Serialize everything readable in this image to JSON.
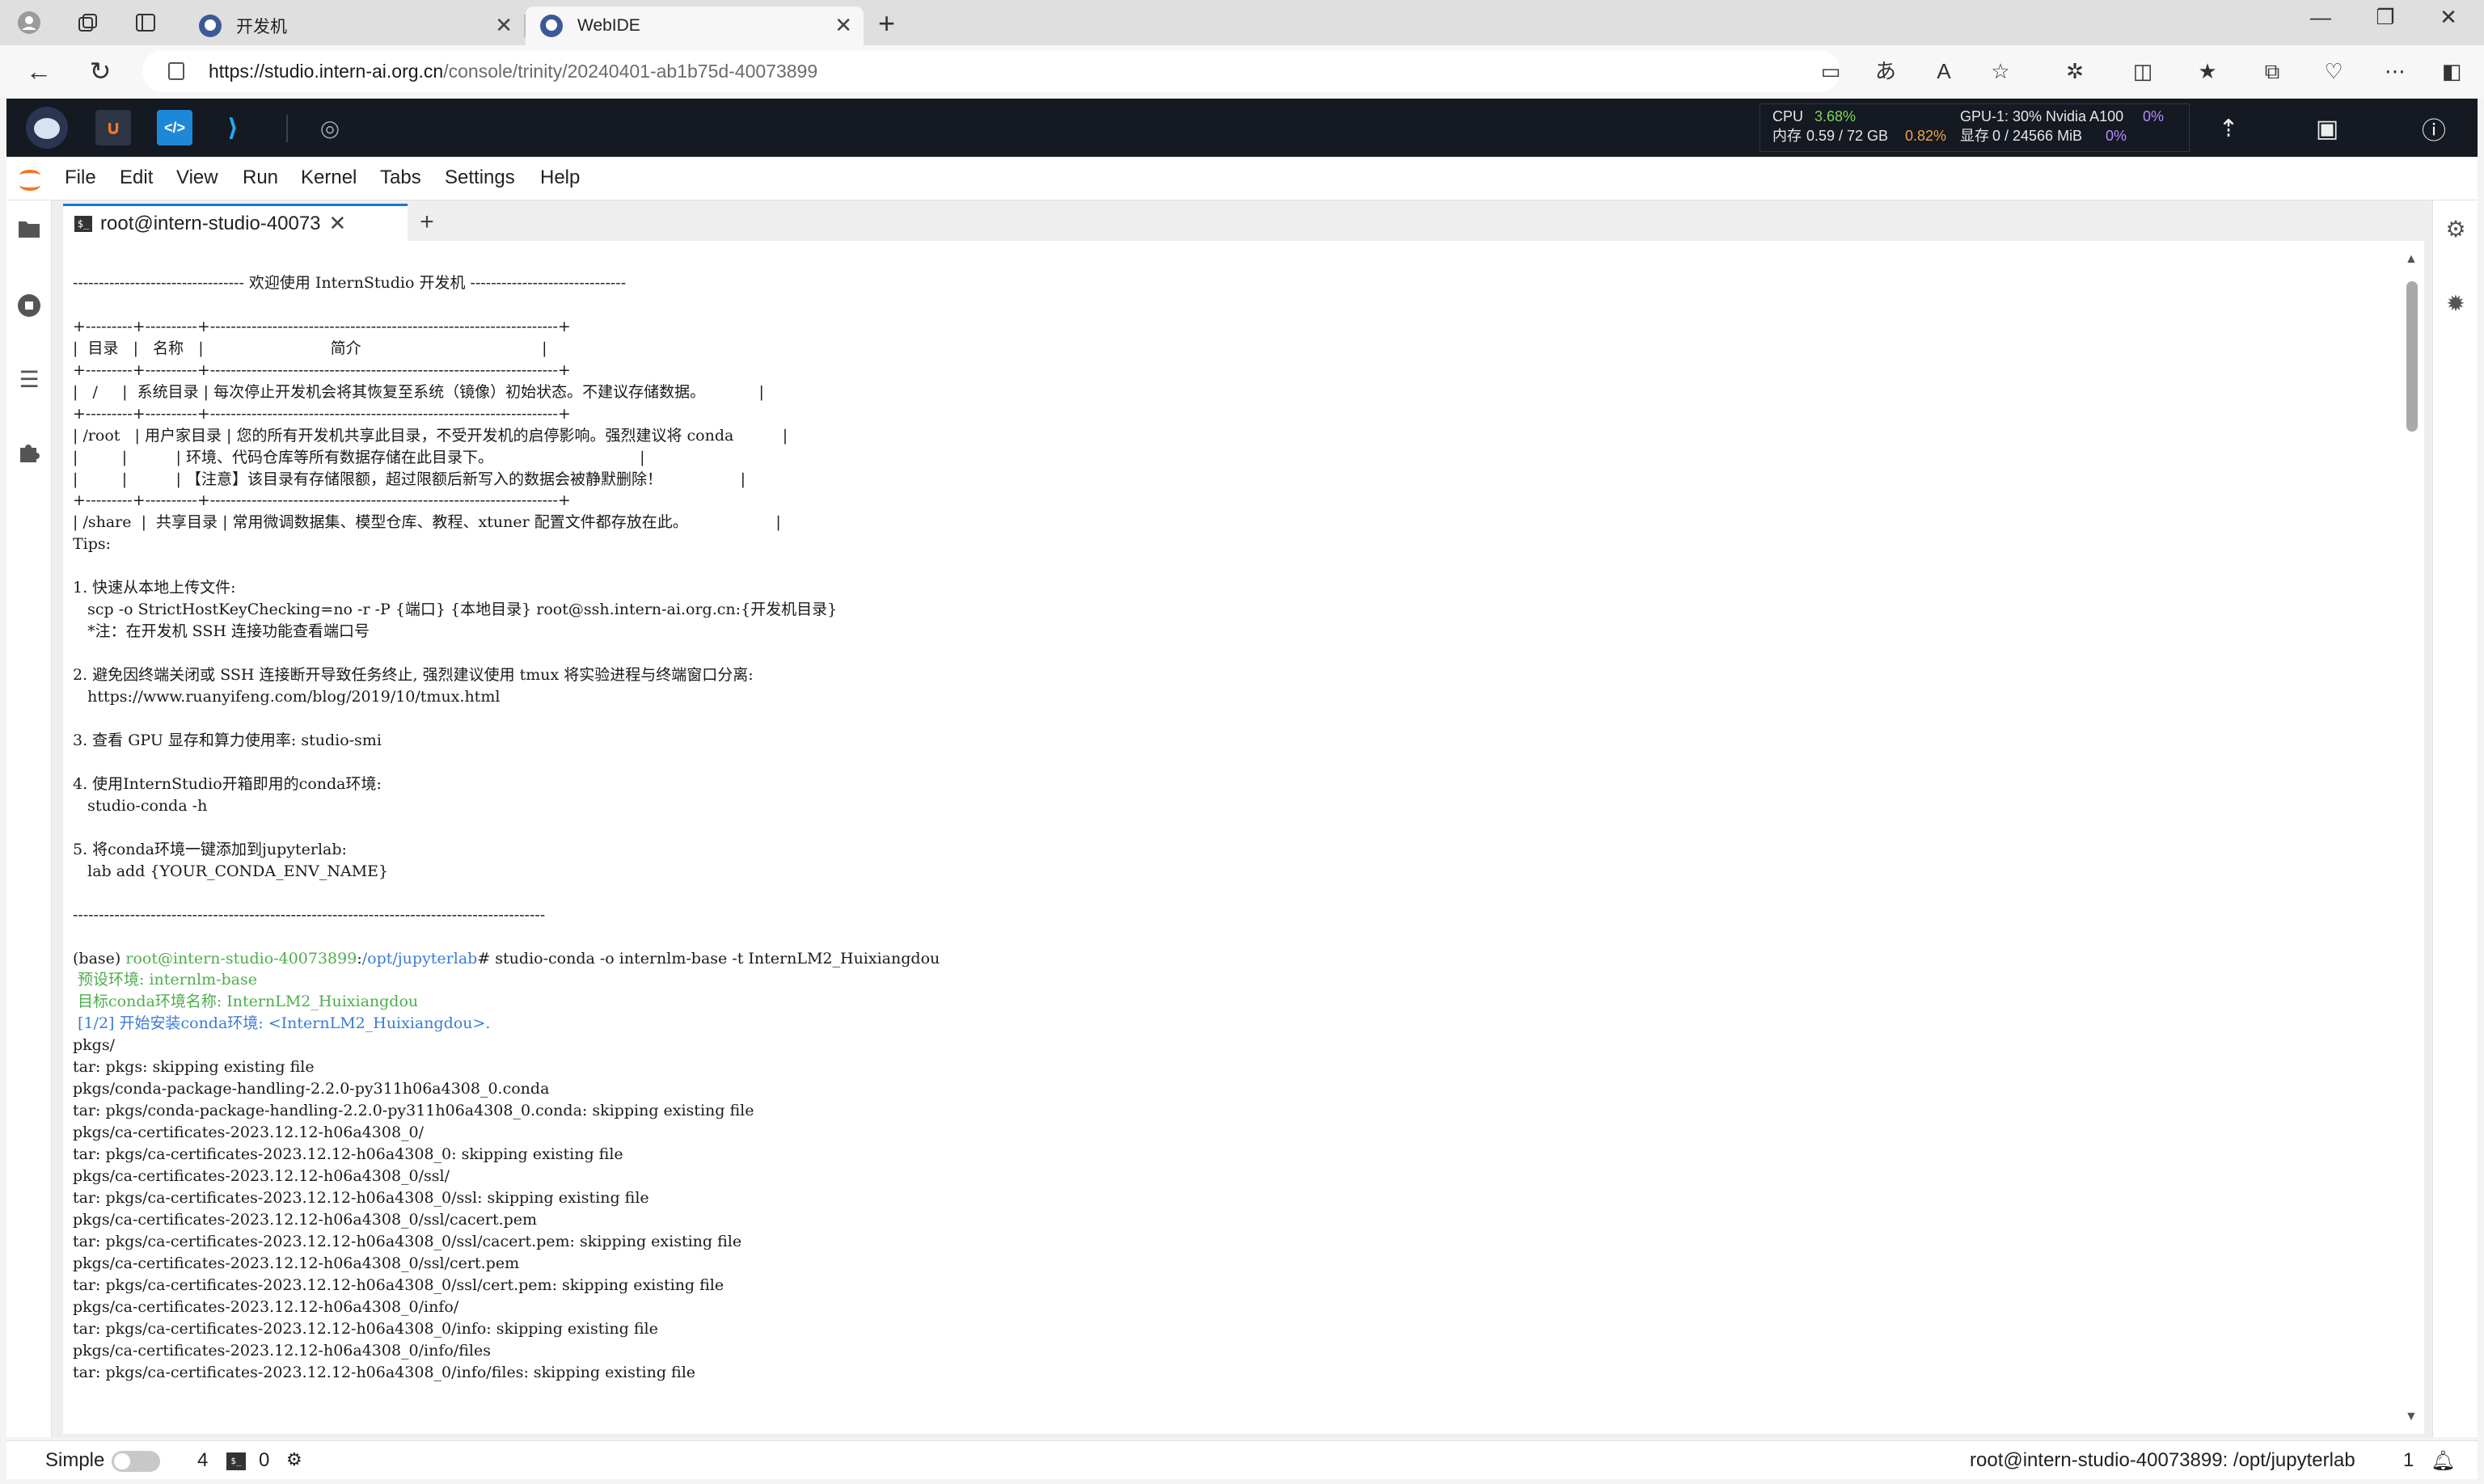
{
  "browser": {
    "tabs": [
      {
        "title": "开发机",
        "active": false
      },
      {
        "title": "WebIDE",
        "active": true
      }
    ],
    "url_host": "https://studio.intern-ai.org.cn",
    "url_path": "/console/trinity/20240401-ab1b75d-40073899",
    "window_controls": [
      "minimize",
      "restore",
      "close"
    ]
  },
  "ide": {
    "stats": {
      "cpu_label": "CPU",
      "cpu_value": "3.68%",
      "mem_label": "内存",
      "mem_value": "0.59 / 72 GB",
      "mem_percent": "0.82%",
      "gpu_label": "GPU-1: 30% Nvidia A100",
      "gpu_percent": "0%",
      "vram_label": "显存",
      "vram_value": "0 / 24566 MiB",
      "vram_percent": "0%"
    },
    "apps": [
      "jupyterlab-icon",
      "code-server-icon",
      "vscode-icon",
      "compass-icon"
    ]
  },
  "menu": [
    "File",
    "Edit",
    "View",
    "Run",
    "Kernel",
    "Tabs",
    "Settings",
    "Help"
  ],
  "dock": {
    "tab_title": "root@intern-studio-40073",
    "add_label": "+"
  },
  "terminal": {
    "lines": [
      {
        "t": ""
      },
      {
        "t": "--------------------------------- 欢迎使用 InternStudio 开发机 ------------------------------"
      },
      {
        "t": ""
      },
      {
        "t": "+---------+----------+-------------------------------------------------------------------+"
      },
      {
        "t": "|  目录   |   名称   |                          简介                                     |"
      },
      {
        "t": "+---------+----------+-------------------------------------------------------------------+"
      },
      {
        "t": "|   /     |  系统目录 | 每次停止开发机会将其恢复至系统（镜像）初始状态。不建议存储数据。           |"
      },
      {
        "t": "+---------+----------+-------------------------------------------------------------------+"
      },
      {
        "t": "| /root   | 用户家目录 | 您的所有开发机共享此目录，不受开发机的启停影响。强烈建议将 conda          |"
      },
      {
        "t": "|         |          | 环境、代码仓库等所有数据存储在此目录下。                              |"
      },
      {
        "t": "|         |          | 【注意】该目录有存储限额，超过限额后新写入的数据会被静默删除！                |"
      },
      {
        "t": "+---------+----------+-------------------------------------------------------------------+"
      },
      {
        "t": "| /share  |  共享目录 | 常用微调数据集、模型仓库、教程、xtuner 配置文件都存放在此。                  |"
      },
      {
        "t": "Tips:"
      },
      {
        "t": ""
      },
      {
        "t": "1. 快速从本地上传文件:"
      },
      {
        "t": "   scp -o StrictHostKeyChecking=no -r -P {端口} {本地目录} root@ssh.intern-ai.org.cn:{开发机目录}"
      },
      {
        "t": "   *注：在开发机 SSH 连接功能查看端口号"
      },
      {
        "t": ""
      },
      {
        "t": "2. 避免因终端关闭或 SSH 连接断开导致任务终止, 强烈建议使用 tmux 将实验进程与终端窗口分离:"
      },
      {
        "t": "   https://www.ruanyifeng.com/blog/2019/10/tmux.html"
      },
      {
        "t": ""
      },
      {
        "t": "3. 查看 GPU 显存和算力使用率: studio-smi"
      },
      {
        "t": ""
      },
      {
        "t": "4. 使用InternStudio开箱即用的conda环境:"
      },
      {
        "t": "   studio-conda -h"
      },
      {
        "t": ""
      },
      {
        "t": "5. 将conda环境一键添加到jupyterlab:"
      },
      {
        "t": "   lab add {YOUR_CONDA_ENV_NAME}"
      },
      {
        "t": ""
      },
      {
        "t": "-------------------------------------------------------------------------------------------"
      },
      {
        "t": ""
      },
      {
        "prompt": true,
        "base": "(base) ",
        "user": "root@intern-studio-40073899",
        "colon": ":",
        "path": "/opt/jupyterlab",
        "cmd": "# studio-conda -o internlm-base -t InternLM2_Huixiangdou"
      },
      {
        "t": " 预设环境: internlm-base",
        "c": "green"
      },
      {
        "t": " 目标conda环境名称: InternLM2_Huixiangdou",
        "c": "green"
      },
      {
        "t": " [1/2] 开始安装conda环境: <InternLM2_Huixiangdou>.",
        "c": "blue"
      },
      {
        "t": "pkgs/"
      },
      {
        "t": "tar: pkgs: skipping existing file"
      },
      {
        "t": "pkgs/conda-package-handling-2.2.0-py311h06a4308_0.conda"
      },
      {
        "t": "tar: pkgs/conda-package-handling-2.2.0-py311h06a4308_0.conda: skipping existing file"
      },
      {
        "t": "pkgs/ca-certificates-2023.12.12-h06a4308_0/"
      },
      {
        "t": "tar: pkgs/ca-certificates-2023.12.12-h06a4308_0: skipping existing file"
      },
      {
        "t": "pkgs/ca-certificates-2023.12.12-h06a4308_0/ssl/"
      },
      {
        "t": "tar: pkgs/ca-certificates-2023.12.12-h06a4308_0/ssl: skipping existing file"
      },
      {
        "t": "pkgs/ca-certificates-2023.12.12-h06a4308_0/ssl/cacert.pem"
      },
      {
        "t": "tar: pkgs/ca-certificates-2023.12.12-h06a4308_0/ssl/cacert.pem: skipping existing file"
      },
      {
        "t": "pkgs/ca-certificates-2023.12.12-h06a4308_0/ssl/cert.pem"
      },
      {
        "t": "tar: pkgs/ca-certificates-2023.12.12-h06a4308_0/ssl/cert.pem: skipping existing file"
      },
      {
        "t": "pkgs/ca-certificates-2023.12.12-h06a4308_0/info/"
      },
      {
        "t": "tar: pkgs/ca-certificates-2023.12.12-h06a4308_0/info: skipping existing file"
      },
      {
        "t": "pkgs/ca-certificates-2023.12.12-h06a4308_0/info/files"
      },
      {
        "t": "tar: pkgs/ca-certificates-2023.12.12-h06a4308_0/info/files: skipping existing file"
      }
    ]
  },
  "statusbar": {
    "simple_label": "Simple",
    "terminals_count": "4",
    "kernels_count": "0",
    "location": "root@intern-studio-40073899: /opt/jupyterlab",
    "notifications": "1"
  }
}
